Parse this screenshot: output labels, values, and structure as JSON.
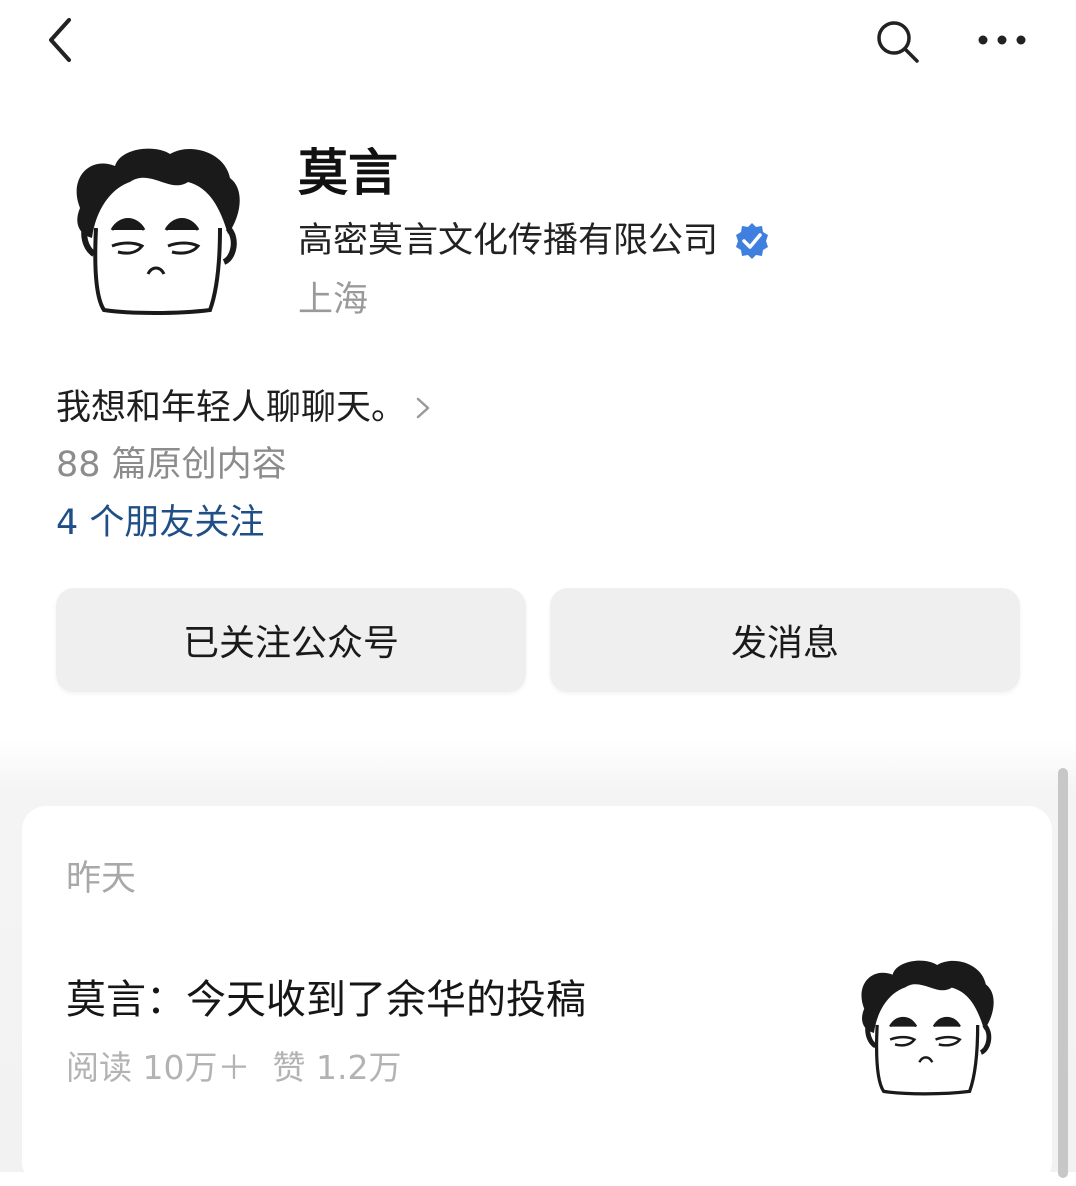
{
  "topbar": {
    "back_icon": "chevron-left-icon",
    "search_icon": "search-icon",
    "more_icon": "more-dots-icon"
  },
  "profile": {
    "avatar_icon": "cartoon-portrait-avatar",
    "name": "莫言",
    "org": "高密莫言文化传播有限公司",
    "verified_icon": "verified-badge-icon",
    "verified_color": "#3f7fe0",
    "location": "上海",
    "bio": "我想和年轻人聊聊天。",
    "articles_count": "88 篇原创内容",
    "friends_follow": "4 个朋友关注",
    "friends_follow_color": "#1f4f86"
  },
  "actions": {
    "follow_label": "已关注公众号",
    "message_label": "发消息"
  },
  "feed": {
    "date_label": "昨天",
    "articles": [
      {
        "title": "莫言：今天收到了余华的投稿",
        "reads": "阅读 10万＋",
        "likes": "赞 1.2万",
        "thumb_icon": "cartoon-portrait-thumbnail"
      }
    ]
  }
}
